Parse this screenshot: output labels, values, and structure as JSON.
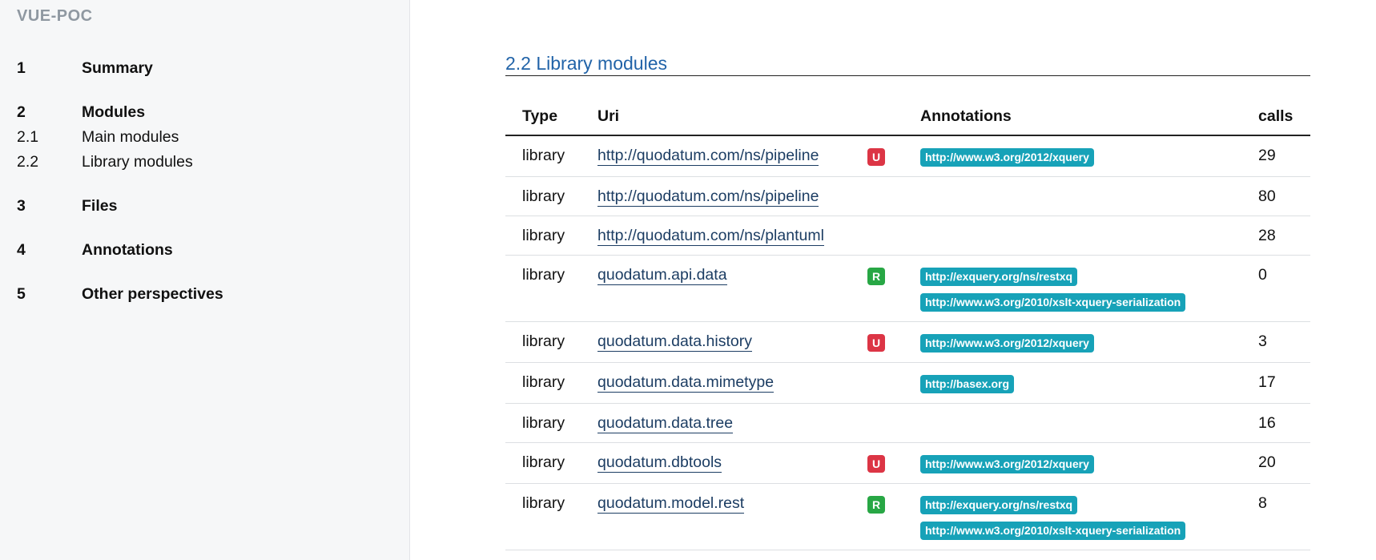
{
  "sidebar": {
    "brand": "VUE-POC",
    "toc": [
      {
        "num": "1",
        "label": "Summary",
        "top": true
      },
      {
        "num": "2",
        "label": "Modules",
        "top": true
      },
      {
        "num": "2.1",
        "label": "Main modules",
        "top": false
      },
      {
        "num": "2.2",
        "label": "Library modules",
        "top": false
      },
      {
        "num": "3",
        "label": "Files",
        "top": true
      },
      {
        "num": "4",
        "label": "Annotations",
        "top": true
      },
      {
        "num": "5",
        "label": "Other perspectives",
        "top": true
      }
    ]
  },
  "main": {
    "section_title": "2.2 Library modules",
    "table": {
      "headers": {
        "type": "Type",
        "uri": "Uri",
        "flag": "",
        "annotations": "Annotations",
        "calls": "calls"
      },
      "rows": [
        {
          "type": "library",
          "uri": "http://quodatum.com/ns/pipeline",
          "flag": "U",
          "annotations": [
            "http://www.w3.org/2012/xquery"
          ],
          "calls": "29"
        },
        {
          "type": "library",
          "uri": "http://quodatum.com/ns/pipeline",
          "flag": "",
          "annotations": [],
          "calls": "80"
        },
        {
          "type": "library",
          "uri": "http://quodatum.com/ns/plantuml",
          "flag": "",
          "annotations": [],
          "calls": "28"
        },
        {
          "type": "library",
          "uri": "quodatum.api.data",
          "flag": "R",
          "annotations": [
            "http://exquery.org/ns/restxq",
            "http://www.w3.org/2010/xslt-xquery-serialization"
          ],
          "calls": "0"
        },
        {
          "type": "library",
          "uri": "quodatum.data.history",
          "flag": "U",
          "annotations": [
            "http://www.w3.org/2012/xquery"
          ],
          "calls": "3"
        },
        {
          "type": "library",
          "uri": "quodatum.data.mimetype",
          "flag": "",
          "annotations": [
            "http://basex.org"
          ],
          "calls": "17"
        },
        {
          "type": "library",
          "uri": "quodatum.data.tree",
          "flag": "",
          "annotations": [],
          "calls": "16"
        },
        {
          "type": "library",
          "uri": "quodatum.dbtools",
          "flag": "U",
          "annotations": [
            "http://www.w3.org/2012/xquery"
          ],
          "calls": "20"
        },
        {
          "type": "library",
          "uri": "quodatum.model.rest",
          "flag": "R",
          "annotations": [
            "http://exquery.org/ns/restxq",
            "http://www.w3.org/2010/xslt-xquery-serialization"
          ],
          "calls": "8"
        }
      ]
    }
  },
  "colors": {
    "flag_U": "#dc3545",
    "flag_R": "#28a745",
    "annotation_badge": "#17a2b8",
    "section_title": "#2163a8",
    "brand": "#8f98a1"
  }
}
